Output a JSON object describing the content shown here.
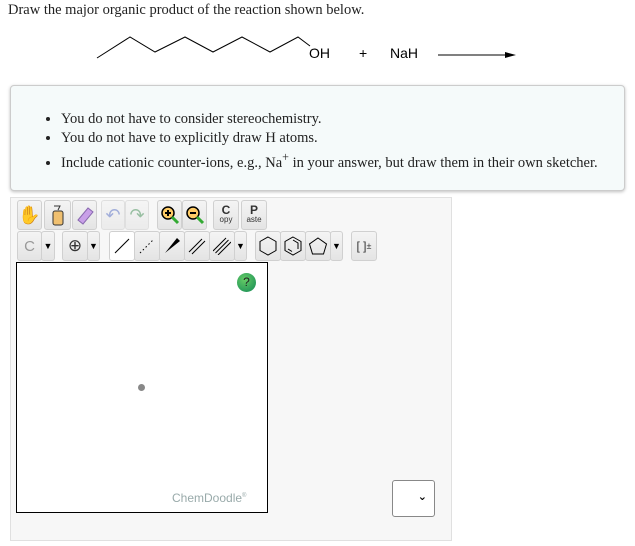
{
  "question": "Draw the major organic product of the reaction shown below.",
  "reaction": {
    "oh": "OH",
    "plus": "+",
    "reagent": "NaH"
  },
  "instructions": [
    "You do not have to consider stereochemistry.",
    "You do not have to explicitly draw H atoms.",
    {
      "pre": "Include cationic counter-ions, e.g., Na",
      "sup": "+",
      "post": " in your answer, but draw them in their own sketcher."
    }
  ],
  "toolbar": {
    "copy_big": "C",
    "copy_small": "opy",
    "paste_big": "P",
    "paste_small": "aste",
    "carbon": "C",
    "bracket": "[ ]",
    "bracket_sup": "±"
  },
  "sketcher": {
    "help": "?",
    "brand": "ChemDoodle",
    "brand_mark": "®"
  },
  "answer_select": {
    "options": [
      ""
    ]
  }
}
